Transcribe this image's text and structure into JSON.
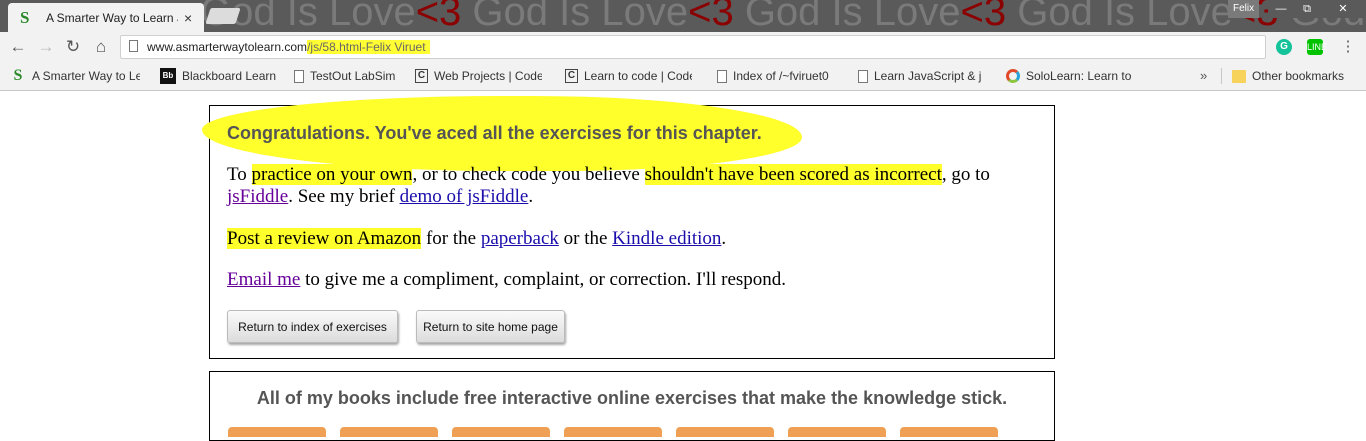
{
  "window": {
    "background_text": "God Is Love<3 God Is Love<3 God Is Love<3 God Is Love<3 God Is Love",
    "profile": "Felix",
    "controls": {
      "minimize": "—",
      "maximize": "⧉",
      "close": "✕"
    }
  },
  "tab": {
    "favicon": "S",
    "title": "A Smarter Way to Learn J",
    "close": "×"
  },
  "toolbar": {
    "back": "←",
    "forward": "→",
    "reload": "↻",
    "home": "⌂",
    "url_domain": "www.asmarterwaytolearn.com",
    "url_path": "/js/58.html-Felix Viruet",
    "grammarly": "G",
    "line": "LINE",
    "menu": "⋮"
  },
  "bookmarks": {
    "items": [
      {
        "label": "A Smarter Way to Le",
        "icon": "smarter-way-icon"
      },
      {
        "label": "Blackboard Learn",
        "icon": "blackboard-icon"
      },
      {
        "label": "TestOut LabSim",
        "icon": "page-icon"
      },
      {
        "label": "Web Projects | Code",
        "icon": "codecademy-icon"
      },
      {
        "label": "Learn to code | Code",
        "icon": "codecademy-icon"
      },
      {
        "label": "Index of /~fviruet0",
        "icon": "page-icon"
      },
      {
        "label": "Learn JavaScript & jC",
        "icon": "page-icon"
      },
      {
        "label": "SoloLearn: Learn to C",
        "icon": "sololearn-icon"
      }
    ],
    "more": "»",
    "other": "Other bookmarks"
  },
  "content": {
    "congrats": "Congratulations. You've aced all the exercises for this chapter.",
    "p1": {
      "a": "To ",
      "b": "practice on your own",
      "c": ", or to check code you believe ",
      "d": "shouldn't have been scored as incorrect",
      "e": ", go to ",
      "link_jsfiddle": "jsFiddle",
      "f": ". See my brief ",
      "link_demo": "demo of jsFiddle",
      "g": "."
    },
    "p2": {
      "review": "Post a review on Amazon",
      "a": " for the ",
      "link_paperback": "paperback",
      "b": " or the ",
      "link_kindle": "Kindle edition",
      "c": "."
    },
    "p3": {
      "link_email": "Email me",
      "a": " to give me a compliment, complaint, or correction. I'll respond."
    },
    "buttons": {
      "index": "Return to index of exercises",
      "home": "Return to site home page"
    },
    "books_line": "All of my books include free interactive online exercises that make the knowledge stick."
  },
  "colors": {
    "highlight": "#ffff2b",
    "link": "#1a0dab",
    "visited_link": "#660099",
    "book_accent": "#f0a055"
  }
}
